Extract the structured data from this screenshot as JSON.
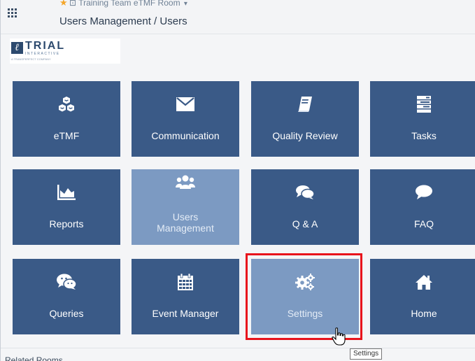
{
  "header": {
    "room_name": "Training Team eTMF Room",
    "breadcrumb": "Users Management / Users"
  },
  "logo": {
    "name": "TRIAL",
    "sub": "INTERACTIVE",
    "tagline": "A TRANSPERFECT COMPANY"
  },
  "tiles": [
    {
      "label": "eTMF",
      "icon": "cubes-icon"
    },
    {
      "label": "Communication",
      "icon": "envelope-icon"
    },
    {
      "label": "Quality Review",
      "icon": "book-icon"
    },
    {
      "label": "Tasks",
      "icon": "tasks-icon"
    },
    {
      "label": "Reports",
      "icon": "area-chart-icon"
    },
    {
      "label": "Users Management",
      "icon": "users-icon",
      "line1": "Users",
      "line2": "Management",
      "selected": true
    },
    {
      "label": "Q & A",
      "icon": "comments-icon"
    },
    {
      "label": "FAQ",
      "icon": "comment-icon"
    },
    {
      "label": "Queries",
      "icon": "wechat-icon"
    },
    {
      "label": "Event Manager",
      "icon": "calendar-icon"
    },
    {
      "label": "Settings",
      "icon": "gears-icon",
      "hovered": true
    },
    {
      "label": "Home",
      "icon": "home-icon"
    }
  ],
  "tooltip": "Settings",
  "related": "Related Rooms",
  "colors": {
    "tile": "#3a5a87",
    "tile_active": "#7c9ac2",
    "highlight": "#e8141c",
    "star": "#f4a62a"
  }
}
